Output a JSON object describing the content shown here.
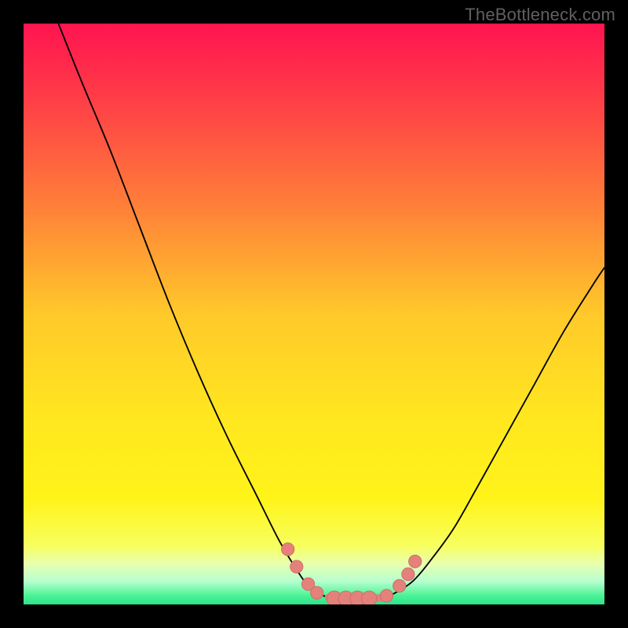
{
  "watermark": "TheBottleneck.com",
  "colors": {
    "black": "#000000",
    "curve": "#000000",
    "marker_fill": "#e4817b",
    "marker_stroke": "#c96a64"
  },
  "chart_data": {
    "type": "line",
    "title": "",
    "xlabel": "",
    "ylabel": "",
    "xlim": [
      0,
      100
    ],
    "ylim": [
      0,
      100
    ],
    "grid": false,
    "legend": false,
    "gradient_stops": [
      {
        "pos": 0.0,
        "color": "#ff1450"
      },
      {
        "pos": 0.12,
        "color": "#ff3a48"
      },
      {
        "pos": 0.3,
        "color": "#ff7a3a"
      },
      {
        "pos": 0.5,
        "color": "#ffc92a"
      },
      {
        "pos": 0.68,
        "color": "#ffe71f"
      },
      {
        "pos": 0.82,
        "color": "#fff41a"
      },
      {
        "pos": 0.9,
        "color": "#f7ff60"
      },
      {
        "pos": 0.93,
        "color": "#e9ffb0"
      },
      {
        "pos": 0.96,
        "color": "#b7ffcf"
      },
      {
        "pos": 0.985,
        "color": "#4bf396"
      },
      {
        "pos": 1.0,
        "color": "#2de28a"
      }
    ],
    "series": [
      {
        "name": "left-curve",
        "x": [
          6,
          10,
          15,
          20,
          25,
          30,
          35,
          40,
          44,
          47,
          49,
          51,
          52.5
        ],
        "y": [
          100,
          90,
          78,
          65,
          52,
          40,
          29,
          19,
          11,
          6,
          3.2,
          1.8,
          1.2
        ]
      },
      {
        "name": "right-curve",
        "x": [
          62,
          64,
          67,
          70,
          74,
          78,
          83,
          88,
          93,
          98,
          100
        ],
        "y": [
          1.2,
          2.0,
          4.0,
          7.5,
          13,
          20,
          29,
          38,
          47,
          55,
          58
        ]
      },
      {
        "name": "trough",
        "x": [
          52.5,
          54,
          56,
          58,
          60,
          62
        ],
        "y": [
          1.2,
          1.0,
          1.0,
          1.0,
          1.0,
          1.2
        ]
      }
    ],
    "markers": [
      {
        "x": 45.5,
        "y": 9.5,
        "r": 1.1
      },
      {
        "x": 47.0,
        "y": 6.5,
        "r": 1.1
      },
      {
        "x": 49.0,
        "y": 3.5,
        "r": 1.1
      },
      {
        "x": 50.5,
        "y": 2.0,
        "r": 1.1
      },
      {
        "x": 53.5,
        "y": 1.0,
        "r": 1.3
      },
      {
        "x": 55.5,
        "y": 1.0,
        "r": 1.3
      },
      {
        "x": 57.5,
        "y": 1.0,
        "r": 1.3
      },
      {
        "x": 59.5,
        "y": 1.0,
        "r": 1.3
      },
      {
        "x": 62.5,
        "y": 1.5,
        "r": 1.1
      },
      {
        "x": 64.7,
        "y": 3.2,
        "r": 1.1
      },
      {
        "x": 66.2,
        "y": 5.2,
        "r": 1.1
      },
      {
        "x": 67.4,
        "y": 7.4,
        "r": 1.1
      }
    ]
  }
}
